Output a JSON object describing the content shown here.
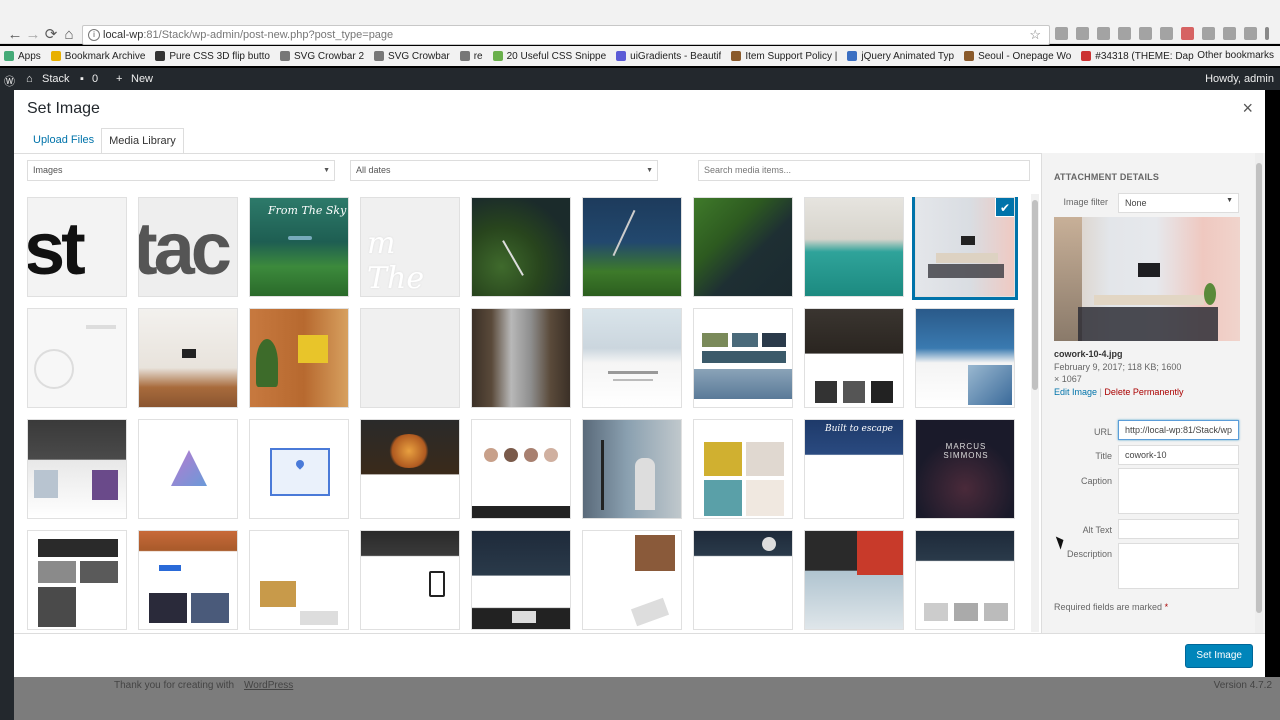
{
  "browser": {
    "url": "local-wp:81/Stack/wp-admin/post-new.php?post_type=page",
    "url_host": "local-wp",
    "url_rest": ":81/Stack/wp-admin/post-new.php?post_type=page"
  },
  "bookmarks": {
    "items": [
      {
        "label": "Apps",
        "color": "#4a7"
      },
      {
        "label": "Bookmark Archive",
        "color": "#e8b000"
      },
      {
        "label": "Pure CSS 3D flip butto",
        "color": "#333"
      },
      {
        "label": "SVG Crowbar 2",
        "color": "#777"
      },
      {
        "label": "SVG Crowbar",
        "color": "#777"
      },
      {
        "label": "re",
        "color": "#777"
      },
      {
        "label": "20 Useful CSS Snippe",
        "color": "#6ab04c"
      },
      {
        "label": "uiGradients - Beautif",
        "color": "#5b5bd6"
      },
      {
        "label": "Item Support Policy |",
        "color": "#8a5a2b"
      },
      {
        "label": "jQuery Animated Typ",
        "color": "#3b6fc2"
      },
      {
        "label": "Seoul - Onepage Wo",
        "color": "#8a5a2b"
      },
      {
        "label": "#34318 (THEME: Dap",
        "color": "#c33"
      }
    ],
    "other": "Other bookmarks"
  },
  "wp_admin_bar": {
    "site": "Stack",
    "comments": "0",
    "new": "New",
    "howdy": "Howdy, admin"
  },
  "footer": {
    "thanks": "Thank you for creating with",
    "link": "WordPress",
    "version": "Version 4.7.2"
  },
  "modal": {
    "title": "Set Image",
    "close": "×",
    "tabs": [
      {
        "label": "Upload Files",
        "active": false
      },
      {
        "label": "Media Library",
        "active": true
      }
    ],
    "filter_type": "Images",
    "filter_date": "All dates",
    "search_placeholder": "Search media items...",
    "primary_button": "Set Image"
  },
  "attachment": {
    "heading": "ATTACHMENT DETAILS",
    "image_filter_label": "Image filter",
    "image_filter_value": "None",
    "filename": "cowork-10-4.jpg",
    "date_size": "February 9, 2017;  118 KB;  1600",
    "dimensions": "× 1067",
    "edit_link": "Edit Image",
    "separator": "|",
    "delete_link": "Delete Permanently",
    "url_label": "URL",
    "url_value": "http://local-wp:81/Stack/wp",
    "title_label": "Title",
    "title_value": "cowork-10",
    "caption_label": "Caption",
    "alt_label": "Alt Text",
    "description_label": "Description",
    "required_text": "Required fields are marked",
    "required_star": "*"
  },
  "thumbs": {
    "row1": [
      {
        "text": "st"
      },
      {
        "text": "tac"
      },
      {
        "text": "From The Sky"
      },
      {
        "text": "m The"
      },
      {
        "text": ""
      },
      {
        "text": ""
      },
      {
        "text": ""
      },
      {
        "text": ""
      },
      {
        "text": ""
      }
    ],
    "row3_card": "Built to escape",
    "row3_name": "MARCUS SIMMONS"
  },
  "colors": {
    "accent": "#0073aa",
    "primary_button": "#0085ba",
    "delete": "#a00",
    "admin_bar": "#23282d"
  }
}
